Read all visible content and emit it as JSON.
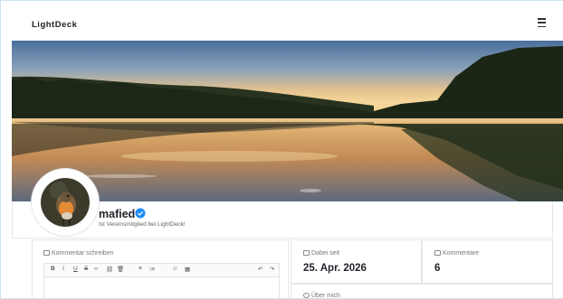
{
  "header": {
    "brand": "LightDeck",
    "menu_icon": "hamburger-menu-icon"
  },
  "banner": {
    "image_desc": "lake-sunset-banner",
    "colors": {
      "sky_top": "#4f78a8",
      "sky_glow": "#f3c98a",
      "water": "#d8a86a",
      "trees": "#1f2a1c"
    }
  },
  "profile": {
    "username": "mafied",
    "tagline": "Ist Vereinsmitglied bei LightDeck!",
    "verified_color": "#1d8cf8",
    "avatar_desc": "robin-bird-avatar"
  },
  "comment": {
    "label": "Kommentar schreiben",
    "toolbar": {
      "bold": "B",
      "italic": "I",
      "underline": "U",
      "strike": "S",
      "code": "‹›",
      "link": "⛓",
      "delete": "🗑",
      "bullet_list": "≡",
      "numbered_list": "⁝≡",
      "emoji": "☺",
      "image": "▦",
      "undo": "↶",
      "redo": "↷"
    }
  },
  "stats": {
    "joined_label": "Dabei seit",
    "joined_value": "25. Apr. 2026",
    "comments_label": "Kommentare",
    "comments_value": "6"
  },
  "about": {
    "label": "Über mich"
  }
}
